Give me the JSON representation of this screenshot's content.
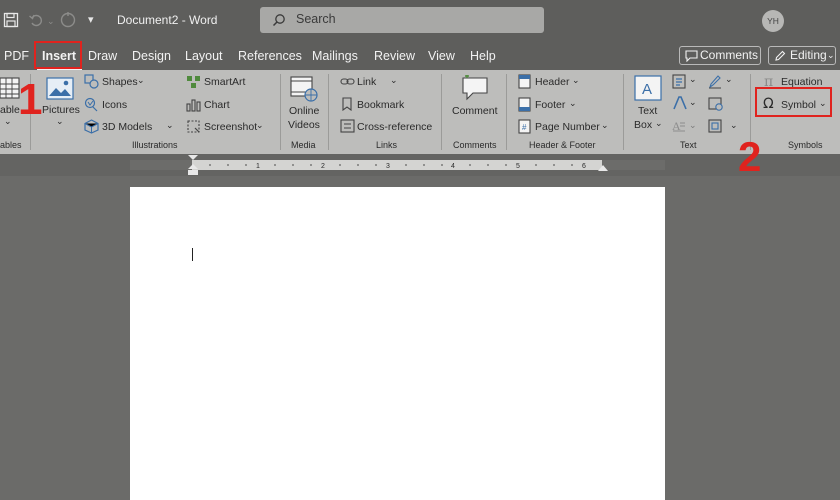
{
  "titlebar": {
    "document_title": "Document2  -  Word",
    "search_placeholder": "Search",
    "avatar_initials": "YH"
  },
  "menu": {
    "tabs": [
      "PDF",
      "Insert",
      "Draw",
      "Design",
      "Layout",
      "References",
      "Mailings",
      "Review",
      "View",
      "Help"
    ],
    "active_tab": "Insert",
    "comments_label": "Comments",
    "editing_label": "Editing"
  },
  "ribbon": {
    "tables": {
      "table_label": "able",
      "group_label": "ables"
    },
    "illustrations": {
      "pictures_label": "Pictures",
      "shapes_label": "Shapes",
      "icons_label": "Icons",
      "models_label": "3D Models",
      "smartart_label": "SmartArt",
      "chart_label": "Chart",
      "screenshot_label": "Screenshot",
      "group_label": "Illustrations"
    },
    "media": {
      "online_label": "Online",
      "videos_label": "Videos",
      "group_label": "Media"
    },
    "links": {
      "link_label": "Link",
      "bookmark_label": "Bookmark",
      "crossref_label": "Cross-reference",
      "group_label": "Links"
    },
    "comments": {
      "comment_label": "Comment",
      "group_label": "Comments"
    },
    "header_footer": {
      "header_label": "Header",
      "footer_label": "Footer",
      "page_number_label": "Page Number",
      "group_label": "Header & Footer"
    },
    "text": {
      "textbox_line1": "Text",
      "textbox_line2": "Box",
      "group_label": "Text"
    },
    "symbols": {
      "equation_label": "Equation",
      "symbol_label": "Symbol",
      "group_label": "Symbols"
    }
  },
  "annotations": {
    "step1": "1",
    "step2": "2"
  },
  "colors": {
    "annotation_red": "#e0231e",
    "ribbon_bg": "#bdbdbb",
    "titlebar_bg": "#5e5e5c"
  }
}
